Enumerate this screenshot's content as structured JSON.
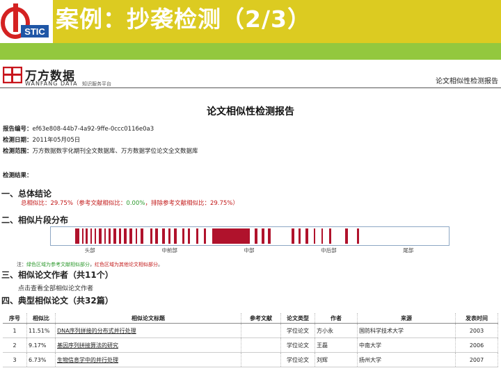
{
  "slide": {
    "title": "案例：抄袭检测（2/3）",
    "logo_text": "STIC"
  },
  "report": {
    "brand_cn": "万方数据",
    "brand_en": "WANFANG DATA",
    "brand_sub": "知识服务平台",
    "corner_title": "论文相似性检测报告",
    "doc_title": "论文相似性检测报告",
    "meta": {
      "id_label": "报告编号：",
      "id_value": "ef63e808-44b7-4a92-9ffe-0ccc0116e0a3",
      "date_label": "检测日期：",
      "date_value": "2011年05月05日",
      "scope_label": "检测范围：",
      "scope_value": "万方数据数字化期刊全文数据库、万方数据学位论文全文数据库",
      "result_label": "检测结果："
    },
    "sections": {
      "s1": "一、总体结论",
      "s2": "二、相似片段分布",
      "s3": "三、相似论文作者（共11个）",
      "s4": "四、典型相似论文（共32篇）"
    },
    "conclusion": {
      "part1": "总相似比：29.75%（参考文献相似比：",
      "ref": "0.00%",
      "part2": "，排除参考文献相似比：29.75%）"
    },
    "segments": {
      "ticks": [
        "头部",
        "中前部",
        "中部",
        "中后部",
        "尾部"
      ],
      "red_runs": [
        [
          0.062,
          0.072
        ],
        [
          0.078,
          0.082
        ],
        [
          0.088,
          0.093
        ],
        [
          0.1,
          0.104
        ],
        [
          0.11,
          0.114
        ],
        [
          0.12,
          0.127
        ],
        [
          0.134,
          0.138
        ],
        [
          0.145,
          0.15
        ],
        [
          0.158,
          0.165
        ],
        [
          0.172,
          0.176
        ],
        [
          0.184,
          0.19
        ],
        [
          0.198,
          0.204
        ],
        [
          0.213,
          0.217
        ],
        [
          0.226,
          0.232
        ],
        [
          0.25,
          0.255
        ],
        [
          0.262,
          0.27
        ],
        [
          0.28,
          0.286
        ],
        [
          0.296,
          0.3
        ],
        [
          0.31,
          0.316
        ],
        [
          0.33,
          0.336
        ],
        [
          0.345,
          0.35
        ],
        [
          0.365,
          0.371
        ],
        [
          0.385,
          0.39
        ],
        [
          0.405,
          0.5
        ],
        [
          0.512,
          0.52
        ],
        [
          0.53,
          0.536
        ],
        [
          0.545,
          0.552
        ],
        [
          0.605,
          0.612
        ],
        [
          0.622,
          0.628
        ],
        [
          0.64,
          0.646
        ],
        [
          0.66,
          0.664
        ],
        [
          0.68,
          0.684
        ],
        [
          0.7,
          0.705
        ],
        [
          0.74,
          0.746
        ],
        [
          0.77,
          0.775
        ]
      ]
    },
    "legend": {
      "prefix": "注：",
      "green": "绿色区域为参考文献相似部分",
      "sep": "，",
      "red": "红色区域为其他论文相似部分",
      "suffix": "。"
    },
    "author_link": "点击查看全部相似论文作者",
    "table": {
      "headers": [
        "序号",
        "相似比",
        "相似论文标题",
        "参考文献",
        "论文类型",
        "作者",
        "来源",
        "发表时间"
      ],
      "rows": [
        {
          "no": "1",
          "sim": "11.51%",
          "title": "DNA序列拼接的分布式并行处理",
          "ref": "",
          "type": "学位论文",
          "author": "方小永",
          "source": "国防科学技术大学",
          "year": "2003"
        },
        {
          "no": "2",
          "sim": "9.17%",
          "title": "基因序列拼接算法的研究",
          "ref": "",
          "type": "学位论文",
          "author": "王磊",
          "source": "中南大学",
          "year": "2006"
        },
        {
          "no": "3",
          "sim": "6.73%",
          "title": "生物信息学中的并行处理",
          "ref": "",
          "type": "学位论文",
          "author": "刘辉",
          "source": "扬州大学",
          "year": "2007"
        }
      ]
    }
  },
  "colors": {
    "header": "#dccb21",
    "band": "#93c83e",
    "title_text": "#ffffff",
    "segment_red": "#b0122c",
    "logo_red": "#d42222",
    "logo_blue": "#1f56a6"
  }
}
